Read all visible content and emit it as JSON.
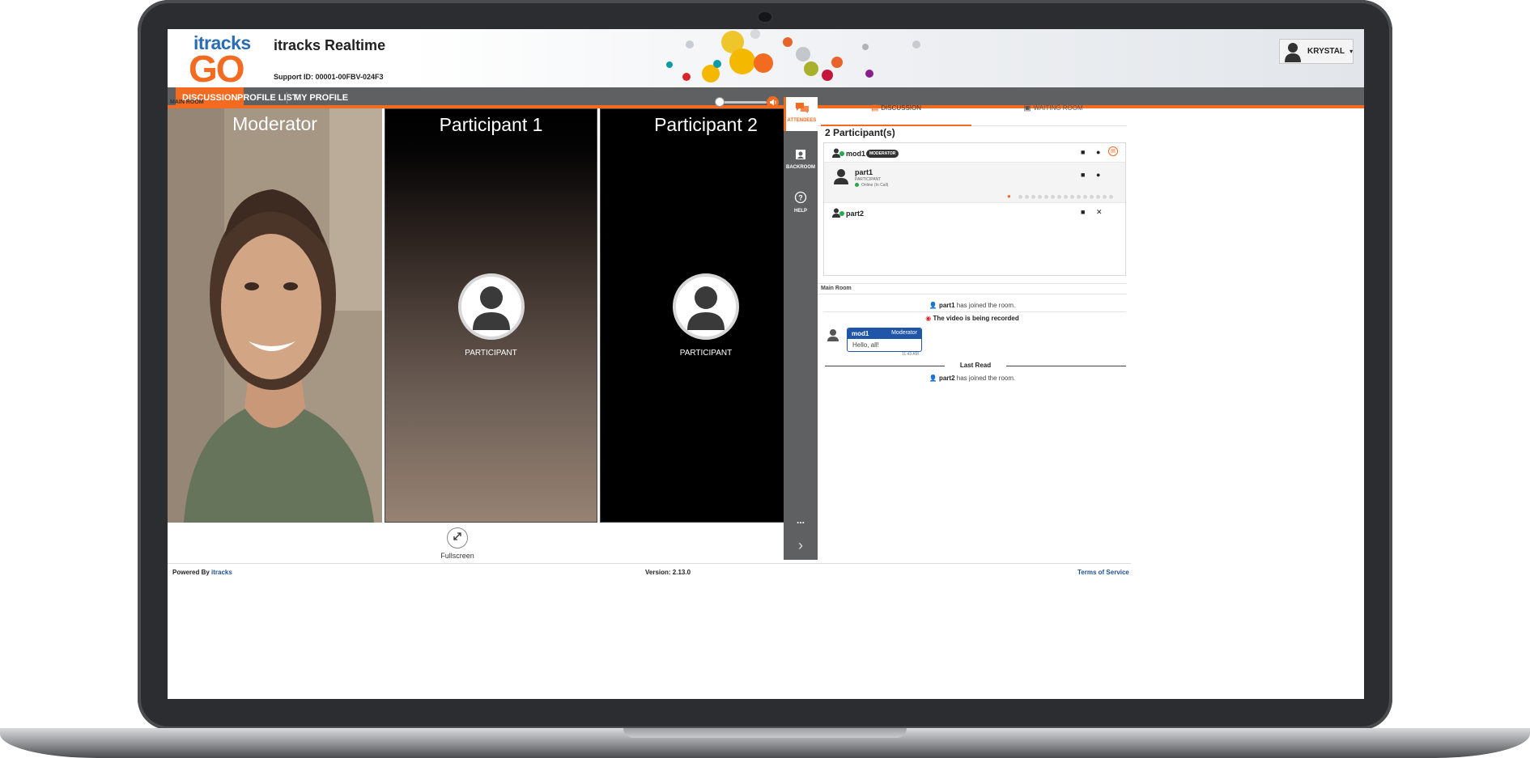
{
  "header": {
    "logo_top": "itracks",
    "logo_bottom": "GO",
    "app_title": "itracks Realtime",
    "support_id": "Support ID: 00001-00FBV-024F3",
    "user_name": "KRYSTAL",
    "user_caret": "▾"
  },
  "nav": {
    "items": [
      {
        "label": "DISCUSSION",
        "active": true
      },
      {
        "label": "PROFILE LIST",
        "active": false
      },
      {
        "label": "MY PROFILE",
        "active": false
      }
    ]
  },
  "video": {
    "room_label": "MAIN ROOM",
    "speaker_icon": "speaker-icon",
    "tiles": [
      {
        "title": "Moderator"
      },
      {
        "title": "Participant 1",
        "sub": "PARTICIPANT"
      },
      {
        "title": "Participant 2",
        "sub": "PARTICIPANT"
      }
    ],
    "fullscreen_label": "Fullscreen"
  },
  "rail": {
    "attendees": "ATTENDEES",
    "backroom": "BACKROOM",
    "help": "HELP",
    "more": "...",
    "collapse": "›"
  },
  "panel": {
    "tab_discussion": "DISCUSSION",
    "tab_waiting": "WAITING ROOM",
    "count": "2 Participant(s)",
    "attendees": [
      {
        "name": "mod1",
        "badge": "MODERATOR"
      },
      {
        "name": "part1",
        "role": "PARTICIPANT",
        "status": "Online (In Call)"
      },
      {
        "name": "part2"
      }
    ]
  },
  "chat": {
    "room_label": "Main Room",
    "msg1_user": "part1",
    "msg1_text": "has joined the room.",
    "recording": "The video is being recorded",
    "bubble_user": "mod1",
    "bubble_role": "Moderator",
    "bubble_text": "Hello, all!",
    "bubble_time": "11:43 AM",
    "last_read": "Last Read",
    "msg2_user": "part2",
    "msg2_text": "has joined the room."
  },
  "footer": {
    "powered": "Powered By",
    "brand": "itracks",
    "version": "Version: 2.13.0",
    "terms": "Terms of Service"
  },
  "colors": {
    "accent": "#f26b21",
    "nav_bg": "#5f6062",
    "chat_blue": "#1f56a8",
    "online": "#27a84a"
  }
}
